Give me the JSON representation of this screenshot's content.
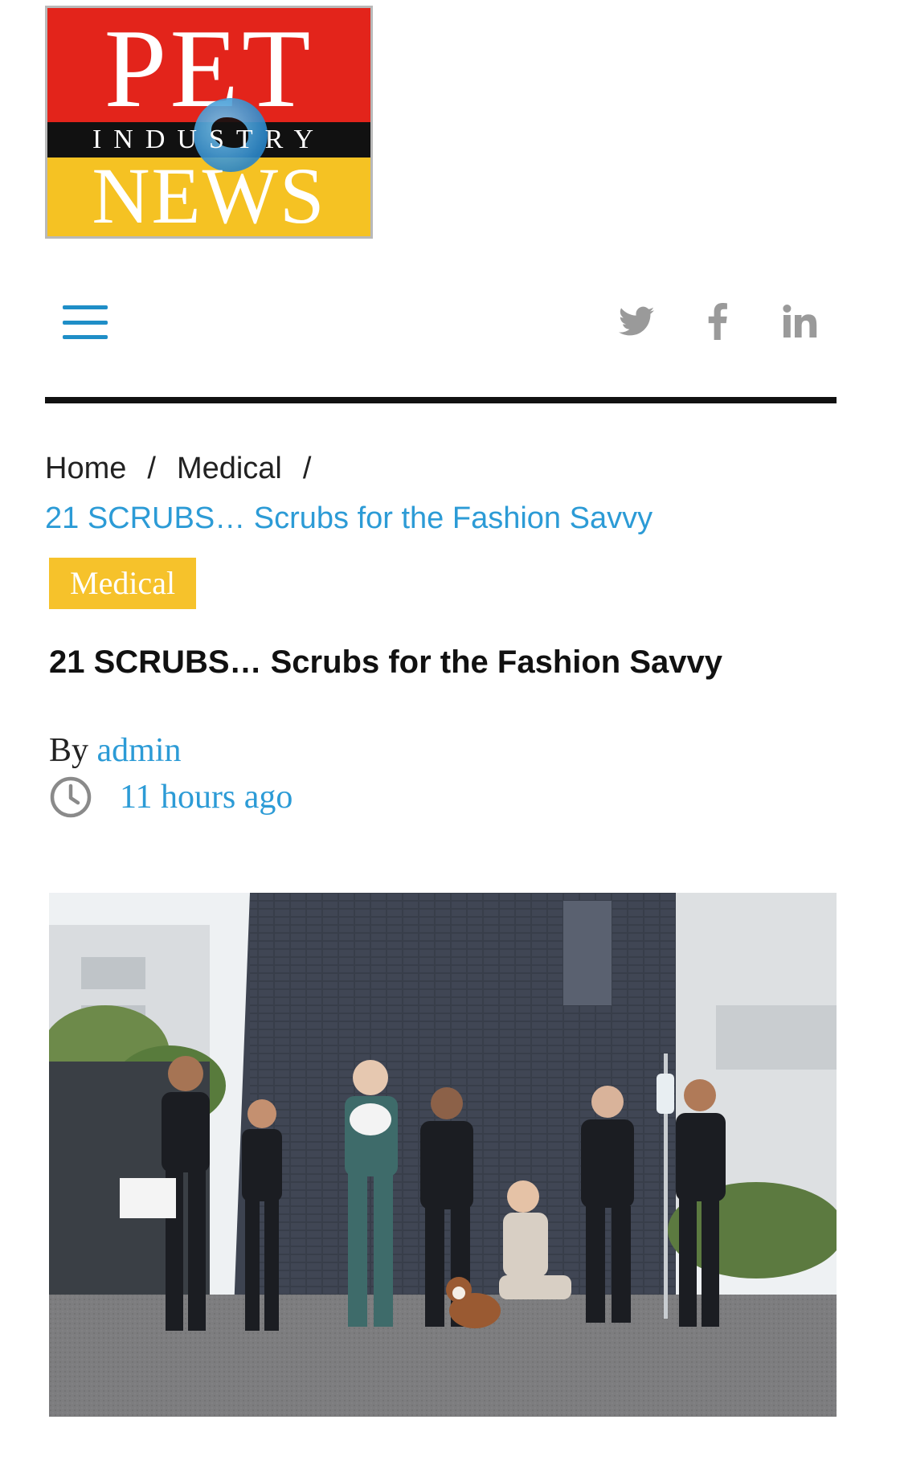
{
  "logo": {
    "line1": "PET",
    "line2": "INDUSTRY",
    "line3": "NEWS"
  },
  "nav": {
    "menu_icon": "hamburger-menu-icon",
    "social": [
      "twitter-icon",
      "facebook-icon",
      "linkedin-icon"
    ]
  },
  "breadcrumb": {
    "home": "Home",
    "separator": "/",
    "category": "Medical",
    "current": "21 SCRUBS… Scrubs for the Fashion Savvy"
  },
  "article": {
    "category_badge": "Medical",
    "title": "21 SCRUBS… Scrubs for the Fashion Savvy",
    "by_label": "By",
    "author": "admin",
    "time_ago": "11 hours ago"
  },
  "colors": {
    "accent_blue": "#2c9bd6",
    "badge_yellow": "#f6c22b",
    "logo_red": "#e3241b",
    "logo_yellow": "#f5c223"
  }
}
